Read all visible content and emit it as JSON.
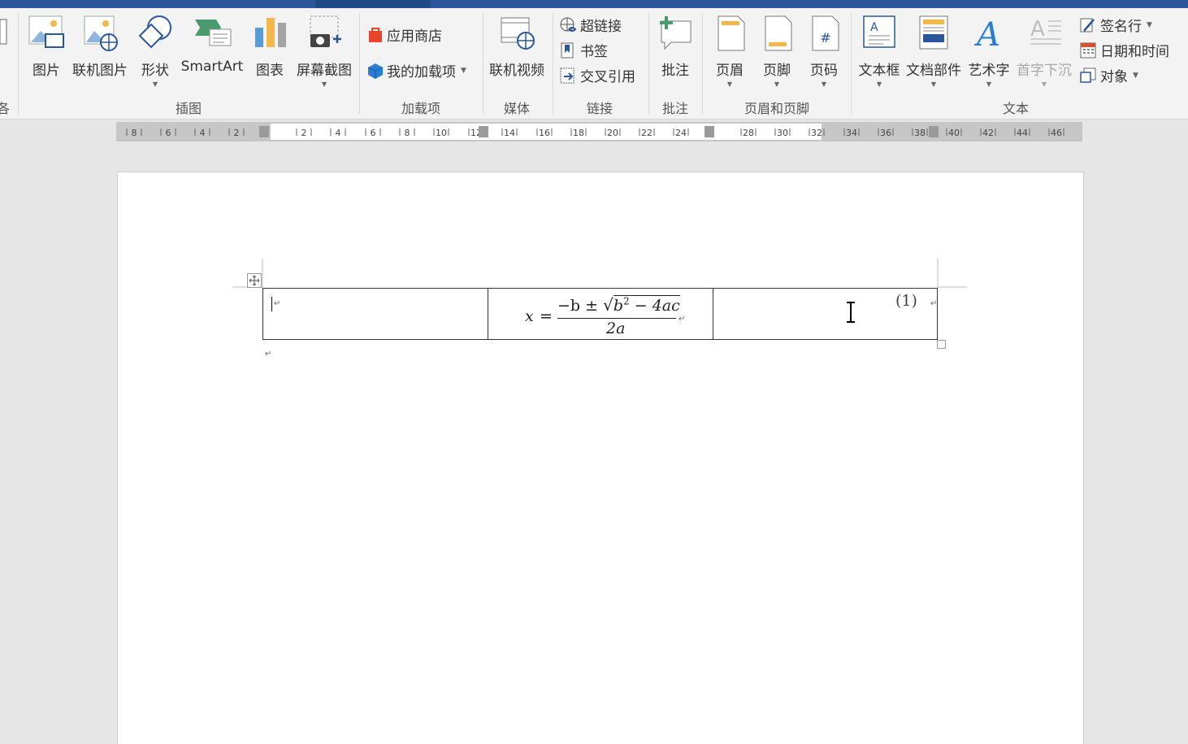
{
  "ribbon": {
    "insert_illustrations": {
      "picture": "图片",
      "online_picture": "联机图片",
      "shapes": "形状",
      "smartart": "SmartArt",
      "chart": "图表",
      "screenshot": "屏幕截图",
      "group_label": "插图"
    },
    "addins": {
      "store": "应用商店",
      "my_addins": "我的加载项",
      "group_label": "加载项"
    },
    "media": {
      "online_video": "联机视频",
      "group_label": "媒体"
    },
    "links": {
      "hyperlink": "超链接",
      "bookmark": "书签",
      "cross_reference": "交叉引用",
      "group_label": "链接"
    },
    "comments": {
      "comment": "批注",
      "group_label": "批注"
    },
    "header_footer": {
      "header": "页眉",
      "footer": "页脚",
      "page_number": "页码",
      "group_label": "页眉和页脚"
    },
    "text": {
      "textbox": "文本框",
      "quick_parts": "文档部件",
      "wordart": "艺术字",
      "drop_cap": "首字下沉",
      "signature_line": "签名行",
      "date_time": "日期和时间",
      "object": "对象",
      "group_label": "文本"
    },
    "left_partial_label": "各"
  },
  "ruler": {
    "labels": [
      "8",
      "6",
      "4",
      "2",
      "2",
      "4",
      "6",
      "8",
      "10",
      "12",
      "14",
      "16",
      "18",
      "20",
      "22",
      "24",
      "28",
      "30",
      "32",
      "34",
      "36",
      "38",
      "40",
      "42",
      "44",
      "46"
    ]
  },
  "document": {
    "equation": {
      "lhs": "x",
      "equals": "=",
      "numerator_prefix": "−b ± ",
      "sqrt_symbol": "√",
      "radicand_b": "b",
      "radicand_exp": "2",
      "radicand_rest": " − 4ac",
      "denominator": "2a"
    },
    "equation_number": "(1)",
    "paragraph_mark": "↵"
  },
  "colors": {
    "title_bar": "#2b579a",
    "ribbon_bg": "#f3f3f3",
    "accent_blue": "#2b579a"
  }
}
